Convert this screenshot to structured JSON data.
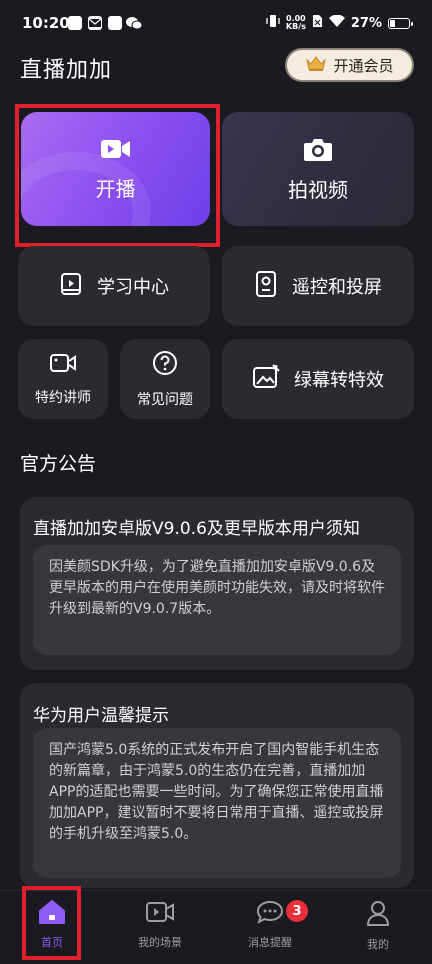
{
  "status_bar": {
    "time": "10:20",
    "speed_value": "0.00",
    "speed_unit": "KB/s",
    "battery": "27%"
  },
  "header": {
    "title": "直播加加",
    "vip_label": "开通会员"
  },
  "features": {
    "start_live": "开播",
    "shoot_video": "拍视频",
    "learning_center": "学习中心",
    "remote_cast": "遥控和投屏",
    "lecturer": "特约讲师",
    "faq": "常见问题",
    "green_screen": "绿幕转特效"
  },
  "announcements": {
    "section_title": "官方公告",
    "items": [
      {
        "title": "直播加加安卓版V9.0.6及更早版本用户须知",
        "body": "因美颜SDK升级，为了避免直播加加安卓版V9.0.6及更早版本的用户在使用美颜时功能失效，请及时将软件升级到最新的V9.0.7版本。"
      },
      {
        "title": "华为用户温馨提示",
        "body": "国产鸿蒙5.0系统的正式发布开启了国内智能手机生态的新篇章，由于鸿蒙5.0的生态仍在完善，直播加加APP的适配也需要一些时间。为了确保您正常使用直播加加APP，建议暂时不要将日常用于直播、遥控或投屏的手机升级至鸿蒙5.0。"
      }
    ]
  },
  "tabbar": {
    "home": "首页",
    "scenes": "我的场景",
    "messages": "消息提醒",
    "messages_badge": "3",
    "mine": "我的"
  },
  "colors": {
    "accent": "#8d5cf5",
    "background": "#1b1a21",
    "card": "#2b2a31",
    "highlight_box": "#e0202a"
  }
}
